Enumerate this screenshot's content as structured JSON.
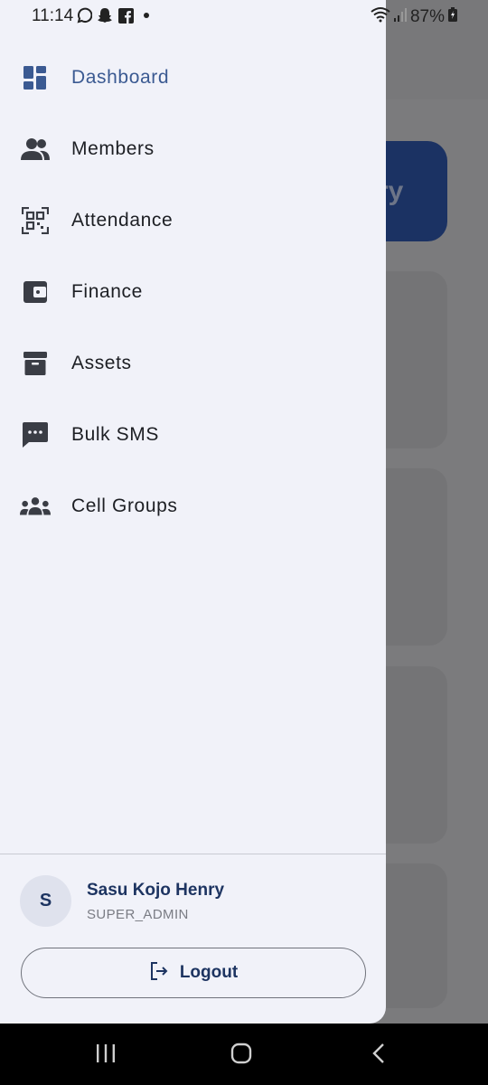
{
  "status_bar": {
    "time": "11:14",
    "battery": "87%",
    "left_icons": [
      "whatsapp-icon",
      "snapchat-icon",
      "facebook-icon",
      "dot-icon"
    ],
    "right_icons": [
      "wifi-icon",
      "signal-icon",
      "battery-charging-icon"
    ]
  },
  "background": {
    "hero_text": "ry"
  },
  "nav": {
    "items": [
      {
        "label": "Dashboard",
        "icon": "dashboard-icon",
        "active": true
      },
      {
        "label": "Members",
        "icon": "people-icon",
        "active": false
      },
      {
        "label": "Attendance",
        "icon": "qr-code-scan-icon",
        "active": false
      },
      {
        "label": "Finance",
        "icon": "wallet-icon",
        "active": false
      },
      {
        "label": "Assets",
        "icon": "archive-icon",
        "active": false
      },
      {
        "label": "Bulk SMS",
        "icon": "sms-icon",
        "active": false
      },
      {
        "label": "Cell Groups",
        "icon": "groups-icon",
        "active": false
      }
    ]
  },
  "profile": {
    "initial": "S",
    "name": "Sasu Kojo Henry",
    "role": "SUPER_ADMIN"
  },
  "logout": {
    "label": "Logout",
    "icon": "logout-icon"
  },
  "system_nav": [
    "recent-apps-icon",
    "home-icon",
    "back-icon"
  ],
  "colors": {
    "accent": "#3b5a92",
    "brand_dark": "#1d3461",
    "drawer_bg": "#f1f2f9",
    "scrim": "#7b7b7d"
  }
}
